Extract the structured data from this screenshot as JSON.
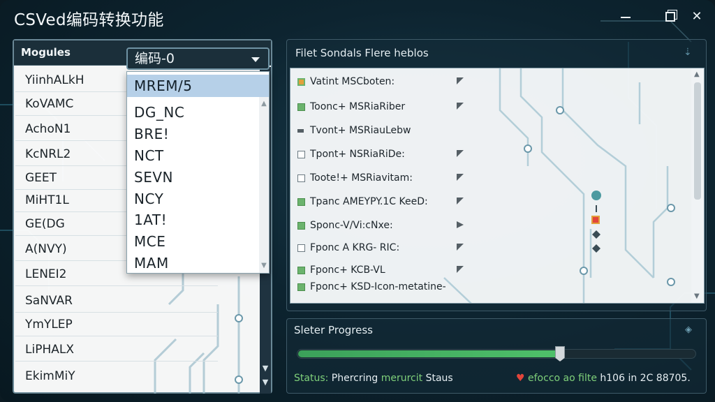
{
  "app": {
    "title": "CSVed编码转换功能",
    "accent": "#6bb36d"
  },
  "window_controls": {
    "minimize_icon": "minimize-icon",
    "maximize_icon": "maximize-icon",
    "close_icon": "close-icon",
    "close_glyph": "✕"
  },
  "left_panel": {
    "title": "Mogules",
    "modules": [
      "YiinhALkH",
      "KoVAMC",
      "AchoN1",
      "KcNRL2",
      "GEET",
      "MiHT1L",
      "GE(DG",
      "A(NVY)",
      "LENEI2",
      "SaNVAR",
      "YmYLEP",
      "LiPHALX",
      "EkimMiY"
    ]
  },
  "encoding_select": {
    "value": "编码-0",
    "options": [
      "MREM/5",
      "DG_NC",
      "BRE!",
      "NCT",
      "SEVN",
      "NCY",
      "1AT!",
      "MCE",
      "MAM"
    ],
    "selected_index": 0
  },
  "files_panel": {
    "title": "Filet Sondals Flere heblos",
    "files": [
      {
        "name": "Vatint MSCboten:",
        "state": "mixed"
      },
      {
        "name": "Toonc+ MSRiaRiber",
        "state": "on"
      },
      {
        "name": "Tvont+ MSRiauLebw",
        "state": "mixed"
      },
      {
        "name": "Tpont+ NSRiaRiDe:",
        "state": "off"
      },
      {
        "name": "Toote!+ MSRiavitam:",
        "state": "off"
      },
      {
        "name": "Tpanc AMEYPY.1C KeeD:",
        "state": "on"
      },
      {
        "name": "Sponc-V/Vi:cNxe:",
        "state": "on"
      },
      {
        "name": "Fponc A KRG- RIC:",
        "state": "off"
      },
      {
        "name": "Fponc+ KCB-VL",
        "state": "on"
      },
      {
        "name": "Fponc+ KSD-Icon-metatine-",
        "state": "on"
      }
    ]
  },
  "progress": {
    "title": "Sleter Progress",
    "fraction": 0.66,
    "status_label": "Status:",
    "status_text_1": "Phercring",
    "status_text_2": "merurcit",
    "status_text_3": "Staus",
    "right_prefix": "efocco ao",
    "right_word": "filte",
    "right_suffix": "h106 in 2C 88705."
  }
}
